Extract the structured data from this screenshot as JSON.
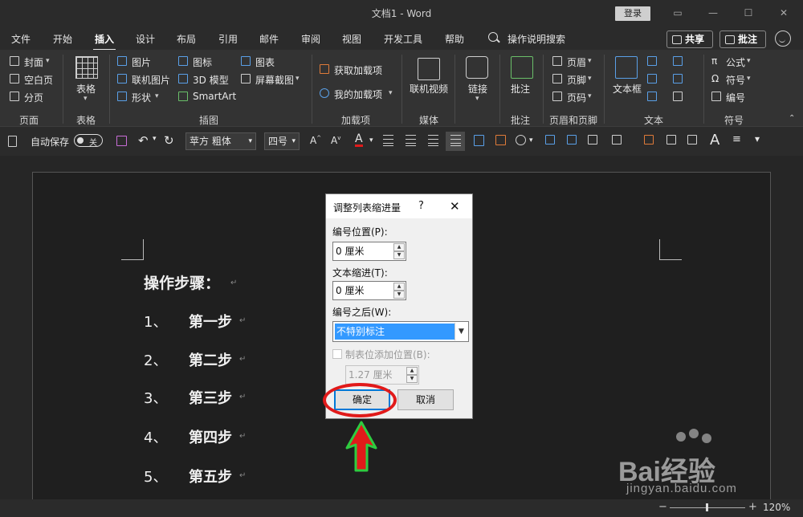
{
  "window": {
    "title": "文档1 - Word",
    "login_label": "登录"
  },
  "menu": {
    "tabs": [
      "文件",
      "开始",
      "插入",
      "设计",
      "布局",
      "引用",
      "邮件",
      "审阅",
      "视图",
      "开发工具",
      "帮助"
    ],
    "active_tab": "插入",
    "search_label": "操作说明搜索",
    "share_label": "共享",
    "comment_label": "批注"
  },
  "ribbon": {
    "pages": {
      "items": [
        "封面",
        "空白页",
        "分页"
      ],
      "group": "页面"
    },
    "tables": {
      "item": "表格",
      "group": "表格"
    },
    "illustrations": {
      "col1": [
        "图片",
        "联机图片",
        "形状"
      ],
      "col2": [
        "图标",
        "3D 模型",
        "SmartArt"
      ],
      "col3": [
        "图表",
        "屏幕截图"
      ],
      "group": "插图"
    },
    "addins": {
      "items": [
        "获取加载项",
        "我的加载项"
      ],
      "group": "加载项"
    },
    "media": {
      "item": "联机视频",
      "group": "媒体"
    },
    "links": {
      "item": "链接",
      "group": ""
    },
    "comments": {
      "item": "批注",
      "group": "批注"
    },
    "header_footer": {
      "items": [
        "页眉",
        "页脚",
        "页码"
      ],
      "group": "页眉和页脚"
    },
    "text": {
      "item": "文本框",
      "group": "文本"
    },
    "symbols": {
      "items": [
        "公式",
        "符号",
        "编号"
      ],
      "group": "符号"
    }
  },
  "qat": {
    "autosave_label": "自动保存",
    "autosave_state": "关",
    "font_name": "苹方 粗体",
    "font_size": "四号"
  },
  "document": {
    "heading": "操作步骤：",
    "paragraph_mark": "↵",
    "steps": [
      {
        "num": "1、",
        "text": "第一步"
      },
      {
        "num": "2、",
        "text": "第二步"
      },
      {
        "num": "3、",
        "text": "第三步"
      },
      {
        "num": "4、",
        "text": "第四步"
      },
      {
        "num": "5、",
        "text": "第五步"
      }
    ]
  },
  "dialog": {
    "title": "调整列表缩进量",
    "help": "?",
    "close": "✕",
    "number_position_label": "编号位置(P):",
    "number_position_value": "0 厘米",
    "text_indent_label": "文本缩进(T):",
    "text_indent_value": "0 厘米",
    "follow_label": "编号之后(W):",
    "follow_value": "不特别标注",
    "tabstop_label": "制表位添加位置(B):",
    "tabstop_value": "1.27 厘米",
    "ok_label": "确定",
    "cancel_label": "取消"
  },
  "status": {
    "zoom": "120%"
  },
  "watermark": {
    "brand": "Bai经验",
    "url": "jingyan.baidu.com"
  },
  "colors": {
    "accent_red": "#e11a1a",
    "arrow_green": "#2ecc40",
    "selection_blue": "#3399ff"
  }
}
